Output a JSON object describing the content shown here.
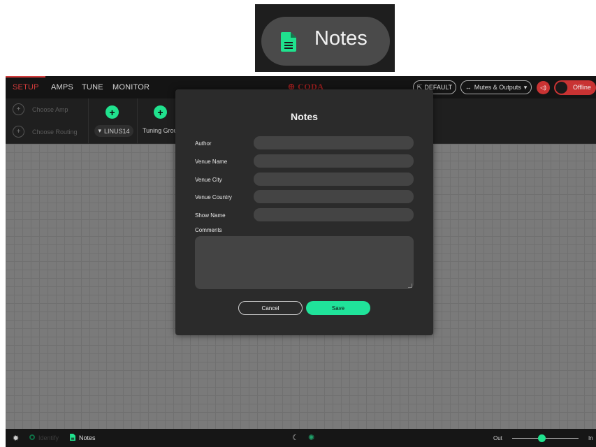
{
  "callout": {
    "label": "Notes",
    "icon": "document-icon"
  },
  "topbar": {
    "tabs": [
      "SETUP",
      "AMPS",
      "TUNE",
      "MONITOR"
    ],
    "logo": "CODA",
    "default_label": "DEFAULT",
    "mutes_label": "Mutes & Outputs",
    "offline_label": "Offline",
    "accent": "#d13b3b"
  },
  "toolbar": {
    "choose_amp": "Choose Amp",
    "choose_routing": "Choose Routing",
    "linus_chip": "LINUS14",
    "tuning_group": "Tuning Grou"
  },
  "modal": {
    "title": "Notes",
    "fields": [
      {
        "label": "Author",
        "value": ""
      },
      {
        "label": "Venue Name",
        "value": ""
      },
      {
        "label": "Venue City",
        "value": ""
      },
      {
        "label": "Venue Country",
        "value": ""
      },
      {
        "label": "Show Name",
        "value": ""
      }
    ],
    "comments_label": "Comments",
    "comments_value": "",
    "cancel_label": "Cancel",
    "save_label": "Save",
    "save_color": "#20e39a"
  },
  "bottombar": {
    "identify_label": "Identify",
    "notes_label": "Notes",
    "out_label": "Out",
    "in_label": "In",
    "monitor_level_fraction": 0.45
  }
}
